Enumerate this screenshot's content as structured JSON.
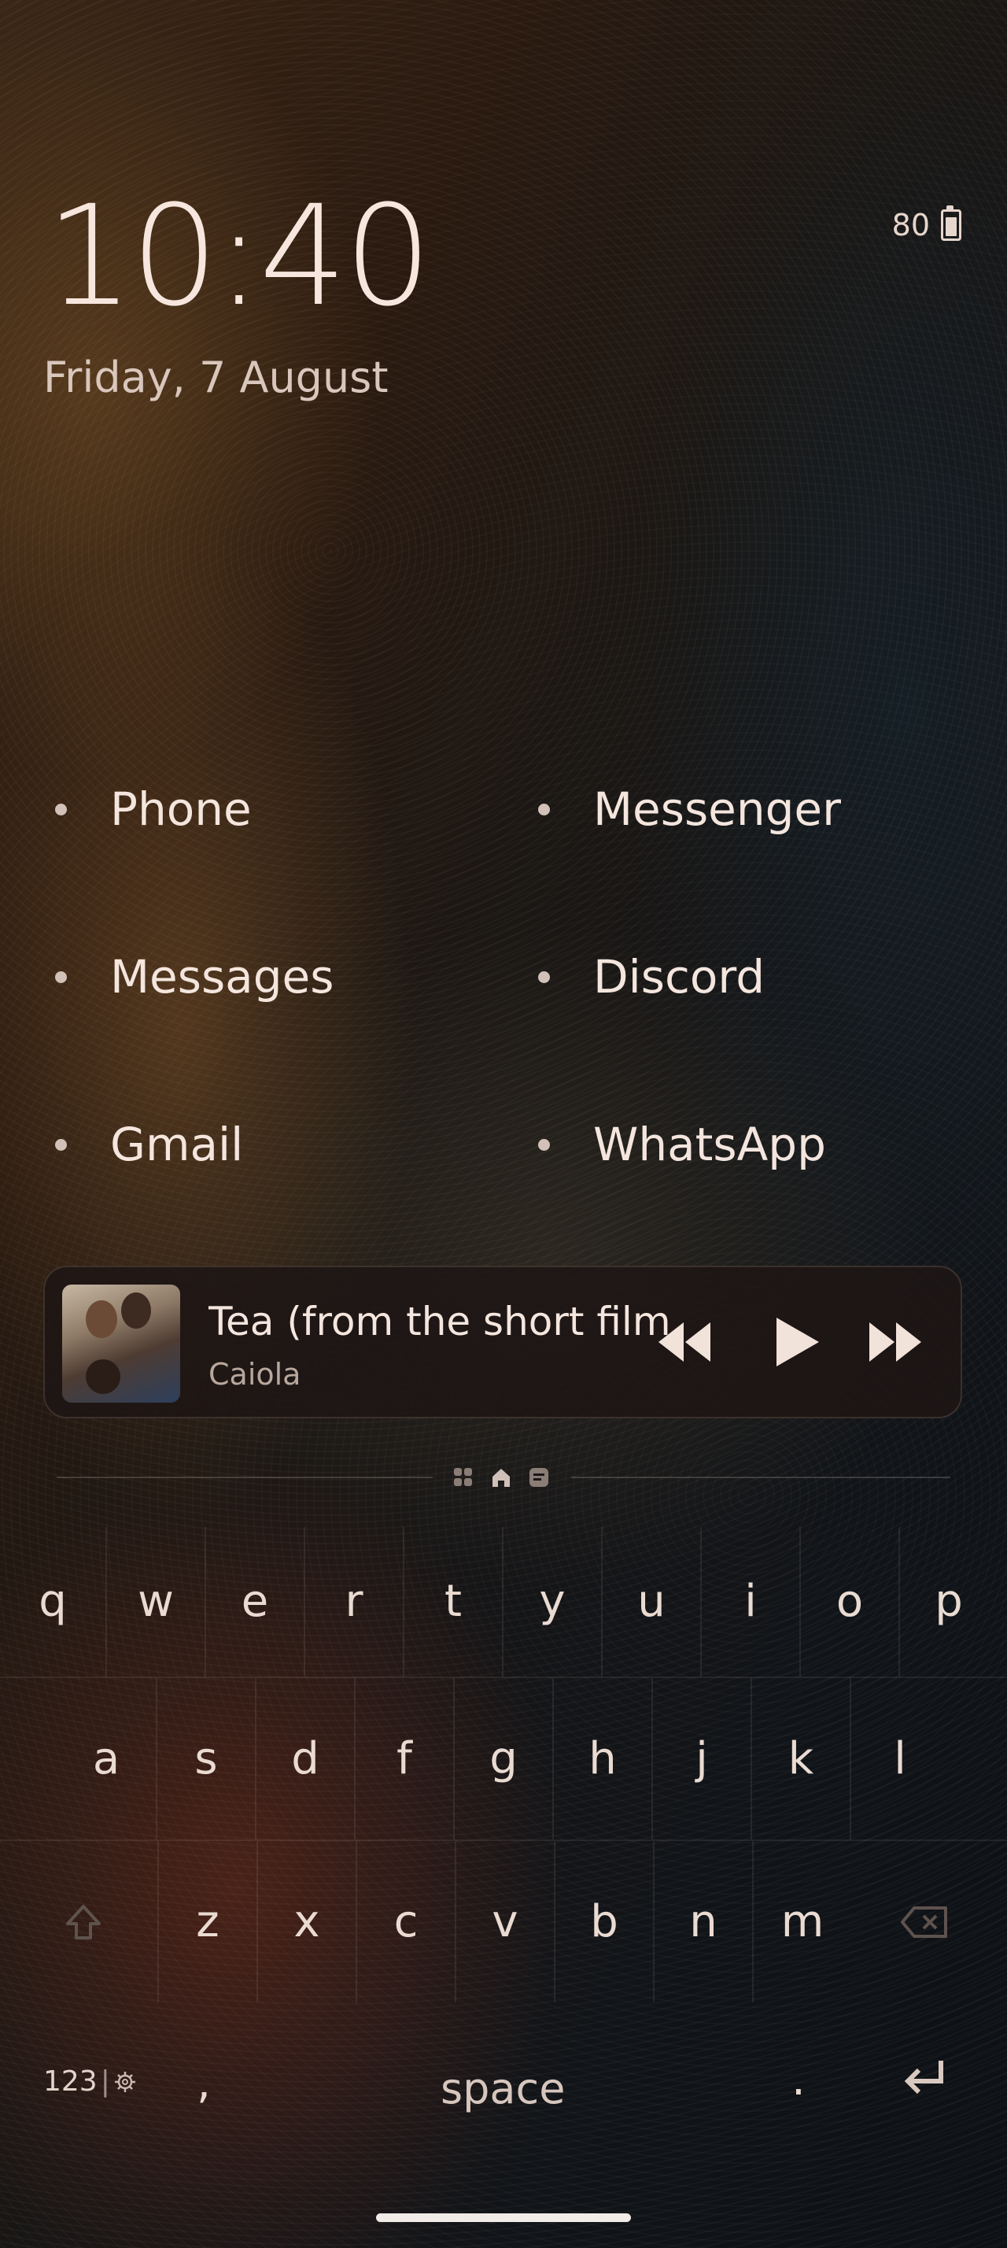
{
  "status": {
    "battery": "80",
    "battery_icon": "battery-icon"
  },
  "lockscreen": {
    "time": "10:40",
    "date": "Friday, 7 August"
  },
  "apps": [
    {
      "label": "Phone"
    },
    {
      "label": "Messenger"
    },
    {
      "label": "Messages"
    },
    {
      "label": "Discord"
    },
    {
      "label": "Gmail"
    },
    {
      "label": "WhatsApp"
    }
  ],
  "media": {
    "title": "Tea (from the short film)",
    "artist": "Caiola",
    "controls": [
      "rewind-icon",
      "play-icon",
      "fast-forward-icon"
    ]
  },
  "pager": {
    "icons": [
      "widgets-icon",
      "home-icon",
      "notes-icon"
    ],
    "active": "home-icon"
  },
  "keyboard": {
    "row1": [
      "q",
      "w",
      "e",
      "r",
      "t",
      "y",
      "u",
      "i",
      "o",
      "p"
    ],
    "row2": [
      "a",
      "s",
      "d",
      "f",
      "g",
      "h",
      "j",
      "k",
      "l"
    ],
    "row3": [
      "z",
      "x",
      "c",
      "v",
      "b",
      "n",
      "m"
    ],
    "numbers_label": "123",
    "comma": ",",
    "space": "space",
    "period": ".",
    "icons": [
      "shift-icon",
      "backspace-icon",
      "gear-icon",
      "enter-icon"
    ]
  },
  "colors": {
    "text": "#f4e6de",
    "player_bg": "#1e1614",
    "home_bar": "#f2ece8"
  }
}
